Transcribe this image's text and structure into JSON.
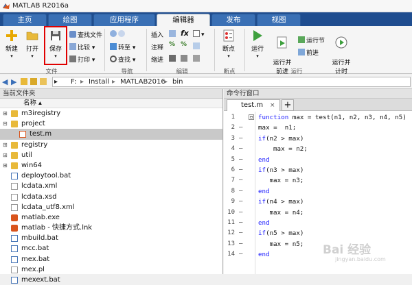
{
  "window": {
    "title": "MATLAB R2016a"
  },
  "tabs": [
    {
      "label": "主页"
    },
    {
      "label": "绘图"
    },
    {
      "label": "应用程序"
    },
    {
      "label": "编辑器",
      "active": true
    },
    {
      "label": "发布"
    },
    {
      "label": "视图"
    }
  ],
  "ribbon": {
    "file": {
      "new_label": "新建",
      "open_label": "打开",
      "save_label": "保存",
      "find_files_label": "查找文件",
      "compare_label": "比较",
      "print_label": "打印",
      "group_label": "文件"
    },
    "nav": {
      "goto_label": "转至",
      "find_label": "查找",
      "group_label": "导航"
    },
    "edit": {
      "insert_label": "插入",
      "comment_label": "注释",
      "indent_label": "缩进",
      "group_label": "编辑"
    },
    "breakpoints": {
      "label": "断点",
      "group_label": "断点"
    },
    "run": {
      "run_label": "运行",
      "run_advance_label": "运行并\n前进",
      "run_section_label": "运行节",
      "advance_label": "前进",
      "run_time_label": "运行并\n计时",
      "group_label": "运行"
    }
  },
  "address": {
    "path": [
      "F:",
      "Install",
      "MATLAB2016",
      "bin"
    ]
  },
  "current_folder": {
    "title": "当前文件夹",
    "name_header": "名称 ▴",
    "items": [
      {
        "name": "m3iregistry",
        "type": "folder",
        "expand": "⊞"
      },
      {
        "name": "project",
        "type": "folder",
        "expand": "⊟"
      },
      {
        "name": "test.m",
        "type": "mfile",
        "selected": true
      },
      {
        "name": "registry",
        "type": "folder",
        "expand": "⊞"
      },
      {
        "name": "util",
        "type": "folder",
        "expand": "⊞"
      },
      {
        "name": "win64",
        "type": "folder",
        "expand": "⊞"
      },
      {
        "name": "deploytool.bat",
        "type": "bat"
      },
      {
        "name": "lcdata.xml",
        "type": "doc"
      },
      {
        "name": "lcdata.xsd",
        "type": "doc"
      },
      {
        "name": "lcdata_utf8.xml",
        "type": "doc"
      },
      {
        "name": "matlab.exe",
        "type": "exe"
      },
      {
        "name": "matlab - 快捷方式.lnk",
        "type": "exe"
      },
      {
        "name": "mbuild.bat",
        "type": "bat"
      },
      {
        "name": "mcc.bat",
        "type": "bat"
      },
      {
        "name": "mex.bat",
        "type": "bat"
      },
      {
        "name": "mex.pl",
        "type": "doc"
      },
      {
        "name": "mexext.bat",
        "type": "bat"
      }
    ]
  },
  "command_window": {
    "title": "命令行窗口"
  },
  "editor": {
    "tab_label": "test.m",
    "close_glyph": "×",
    "add_glyph": "+",
    "lines": [
      {
        "n": "1",
        "dash": "",
        "fold": "⊟",
        "kw": "function",
        "text": " max = test(n1, n2, n3, n4, n5)",
        "indent": 0
      },
      {
        "n": "2",
        "dash": "—",
        "fold": "",
        "kw": "",
        "text": "max =  n1;",
        "indent": 0
      },
      {
        "n": "3",
        "dash": "—",
        "fold": "",
        "kw": "if",
        "text": "(n2 > max)",
        "indent": 0
      },
      {
        "n": "4",
        "dash": "—",
        "fold": "",
        "kw": "",
        "text": "max = n2;",
        "indent": 4
      },
      {
        "n": "5",
        "dash": "—",
        "fold": "",
        "kw": "end",
        "text": "",
        "indent": 0
      },
      {
        "n": "6",
        "dash": "—",
        "fold": "",
        "kw": "if",
        "text": "(n3 > max)",
        "indent": 0
      },
      {
        "n": "7",
        "dash": "—",
        "fold": "",
        "kw": "",
        "text": "max = n3;",
        "indent": 3
      },
      {
        "n": "8",
        "dash": "—",
        "fold": "",
        "kw": "end",
        "text": "",
        "indent": 0
      },
      {
        "n": "9",
        "dash": "—",
        "fold": "",
        "kw": "if",
        "text": "(n4 > max)",
        "indent": 0
      },
      {
        "n": "10",
        "dash": "—",
        "fold": "",
        "kw": "",
        "text": "max = n4;",
        "indent": 3
      },
      {
        "n": "11",
        "dash": "—",
        "fold": "",
        "kw": "end",
        "text": "",
        "indent": 0
      },
      {
        "n": "12",
        "dash": "—",
        "fold": "",
        "kw": "if",
        "text": "(n5 > max)",
        "indent": 0
      },
      {
        "n": "13",
        "dash": "—",
        "fold": "",
        "kw": "",
        "text": "max = n5;",
        "indent": 3
      },
      {
        "n": "14",
        "dash": "—",
        "fold": "",
        "kw": "end",
        "text": "",
        "indent": 0
      }
    ]
  },
  "watermark": {
    "text": "Bai 经验",
    "sub": "jingyan.baidu.com"
  }
}
